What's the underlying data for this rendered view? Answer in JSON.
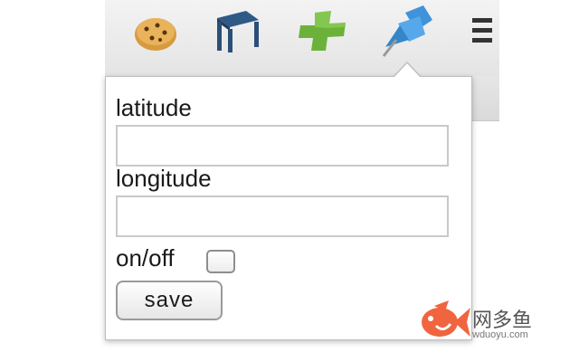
{
  "toolbar": {
    "icons": [
      "cookie-icon",
      "chair-icon",
      "plus-icon",
      "pushpin-icon",
      "menu-icon"
    ]
  },
  "popup": {
    "latitude_label": "latitude",
    "latitude_value": "",
    "longitude_label": "longitude",
    "longitude_value": "",
    "onoff_label": "on/off",
    "onoff_checked": false,
    "save_label": "save"
  },
  "watermark": {
    "brand": "网多鱼",
    "url": "wduoyu.com"
  }
}
